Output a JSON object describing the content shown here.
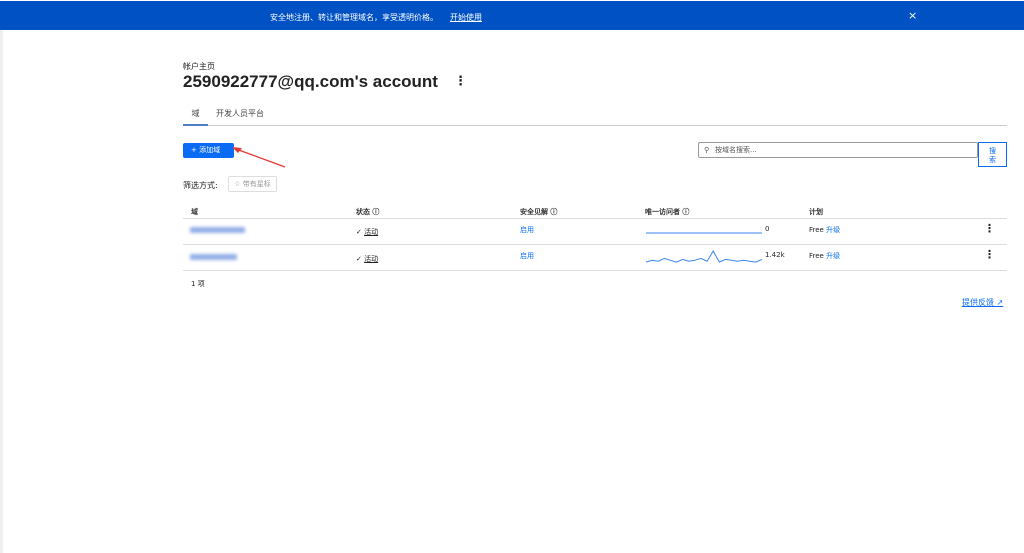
{
  "banner": {
    "message": "安全地注册、转让和管理域名，享受透明价格。",
    "cta": "开始使用",
    "close": "×"
  },
  "breadcrumb": "帐户主页",
  "title": "2590922777@qq.com's account",
  "menu": "⋮",
  "tabs": [
    {
      "label": "域",
      "active": true
    },
    {
      "label": "开发人员平台",
      "active": false
    }
  ],
  "add_button": "+ 添加域",
  "search": {
    "placeholder": "按域名搜索...",
    "button_line1": "搜",
    "button_line2": "索"
  },
  "filter": {
    "label": "筛选方式:",
    "chip": "☆ 带有星标"
  },
  "table": {
    "headers": [
      "域",
      "状态 ⓘ",
      "安全见解 ⓘ",
      "唯一访问者 ⓘ",
      "计划"
    ],
    "rows": [
      {
        "status": "活动",
        "insight": "启用",
        "visitors": "0",
        "plan": "Free",
        "upgrade": "升级",
        "spark": [
          0,
          0,
          0,
          0,
          0,
          0,
          0,
          0,
          0,
          0
        ]
      },
      {
        "status": "活动",
        "insight": "启用",
        "visitors": "1.42k",
        "plan": "Free",
        "upgrade": "升级",
        "spark": [
          2,
          4,
          3,
          6,
          4,
          2,
          5,
          3,
          4,
          6,
          3,
          14,
          2,
          5,
          4,
          3,
          4,
          3,
          2,
          5
        ]
      }
    ]
  },
  "count": "1 项",
  "feedback": "提供反馈 ↗",
  "colors": {
    "banner": "#0051c3",
    "accent": "#0a6cf5",
    "arrow": "#e53935"
  }
}
